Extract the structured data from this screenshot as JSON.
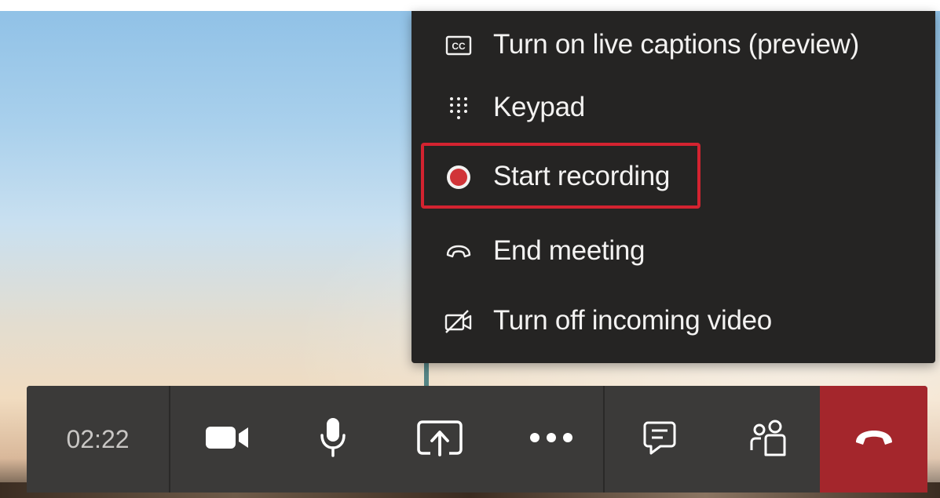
{
  "menu": {
    "items": [
      {
        "label": "Turn on live captions (preview)",
        "icon": "closed-captions-icon"
      },
      {
        "label": "Keypad",
        "icon": "keypad-icon"
      },
      {
        "label": "Start recording",
        "icon": "record-icon"
      },
      {
        "label": "End meeting",
        "icon": "end-call-icon"
      },
      {
        "label": "Turn off incoming video",
        "icon": "video-off-icon"
      }
    ],
    "highlighted_item": "Start recording"
  },
  "control_bar": {
    "timer": "02:22",
    "buttons": [
      {
        "name": "camera",
        "icon": "video-camera-icon"
      },
      {
        "name": "microphone",
        "icon": "microphone-icon"
      },
      {
        "name": "share",
        "icon": "share-screen-icon"
      },
      {
        "name": "more",
        "icon": "more-options-icon"
      },
      {
        "name": "chat",
        "icon": "chat-icon"
      },
      {
        "name": "participants",
        "icon": "participants-icon"
      },
      {
        "name": "hang-up",
        "icon": "hang-up-icon"
      }
    ]
  },
  "colors": {
    "menu_bg": "#252423",
    "bar_bg": "#3b3a39",
    "hangup_bg": "#a4262c",
    "record_red": "#d13438",
    "highlight_border": "#d32330",
    "menu_text": "#f3f2f1"
  }
}
